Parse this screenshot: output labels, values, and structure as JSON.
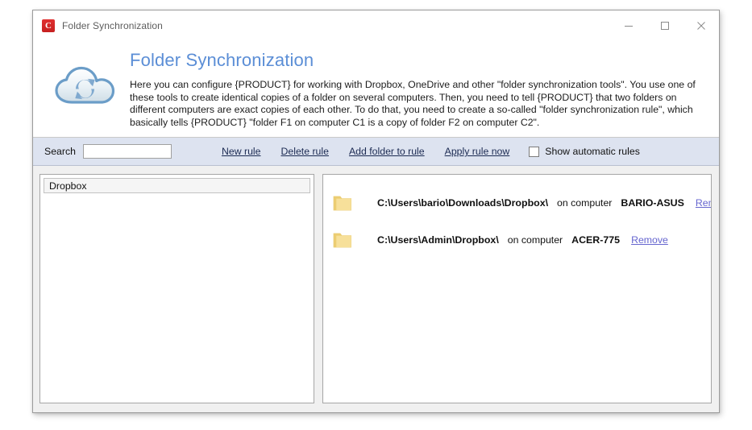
{
  "window": {
    "title": "Folder Synchronization",
    "app_icon": "C",
    "controls": {
      "minimize": "minimize-icon",
      "maximize": "maximize-icon",
      "close": "close-icon"
    }
  },
  "header": {
    "icon": "cloud-sync-icon",
    "title": "Folder Synchronization",
    "description": "Here you can configure {PRODUCT} for working with Dropbox, OneDrive and other \"folder synchronization tools\". You use one of these tools to create identical copies of a folder on several computers. Then, you need to tell {PRODUCT} that two folders on different computers are exact copies of each other. To do that, you need to create a so-called \"folder synchronization rule\", which basically tells {PRODUCT} \"folder F1 on computer C1 is a copy of folder F2 on computer C2\"."
  },
  "toolbar": {
    "search_label": "Search",
    "search_value": "",
    "search_placeholder": "",
    "new_rule": "New rule",
    "delete_rule": "Delete rule",
    "add_folder_to_rule": "Add folder to rule",
    "apply_rule_now": "Apply rule now",
    "show_automatic_rules": "Show automatic rules",
    "show_automatic_rules_checked": false
  },
  "rules_panel": {
    "items": [
      {
        "label": "Dropbox",
        "selected": true
      }
    ]
  },
  "folders_panel": {
    "on_computer_label": "on computer",
    "remove_label": "Remove",
    "rows": [
      {
        "path": "C:\\Users\\bario\\Downloads\\Dropbox\\",
        "on_computer": "on computer",
        "computer": "BARIO-ASUS",
        "remove": "Remove"
      },
      {
        "path": "C:\\Users\\Admin\\Dropbox\\",
        "on_computer": "on computer",
        "computer": "ACER-775",
        "remove": "Remove"
      }
    ]
  },
  "colors": {
    "accent_blue": "#5b8ed6",
    "toolbar_bg": "#dde3f0",
    "link": "#1b2a52",
    "remove_link": "#6565cf",
    "folder_yellow": "#f2d06b",
    "app_icon_red": "#d32b2b"
  }
}
